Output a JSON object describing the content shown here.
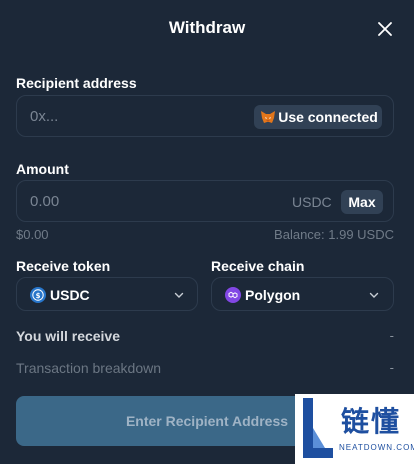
{
  "header": {
    "title": "Withdraw"
  },
  "recipient": {
    "label": "Recipient address",
    "placeholder": "0x...",
    "use_connected_label": "Use connected"
  },
  "amount": {
    "label": "Amount",
    "placeholder": "0.00",
    "unit": "USDC",
    "max_label": "Max",
    "usd_value": "$0.00",
    "balance": "Balance: 1.99 USDC"
  },
  "receive_token": {
    "label": "Receive token",
    "value": "USDC"
  },
  "receive_chain": {
    "label": "Receive chain",
    "value": "Polygon"
  },
  "summary": {
    "you_will_receive_label": "You will receive",
    "you_will_receive_value": "-",
    "breakdown_label": "Transaction breakdown",
    "breakdown_value": "-"
  },
  "cta": {
    "label": "Enter Recipient Address"
  },
  "watermark": {
    "cn": "链懂",
    "en": "NEATDOWN.COM"
  },
  "colors": {
    "background": "#1c2838",
    "field_border": "#2d3b4d",
    "pill": "#314155",
    "cta": "#3b6888",
    "usdc": "#2775ca",
    "polygon": "#8247e5",
    "metamask": "#e2761b"
  },
  "icons": [
    "close-icon",
    "metamask-fox-icon",
    "usdc-token-icon",
    "polygon-chain-icon",
    "chevron-down-icon"
  ]
}
